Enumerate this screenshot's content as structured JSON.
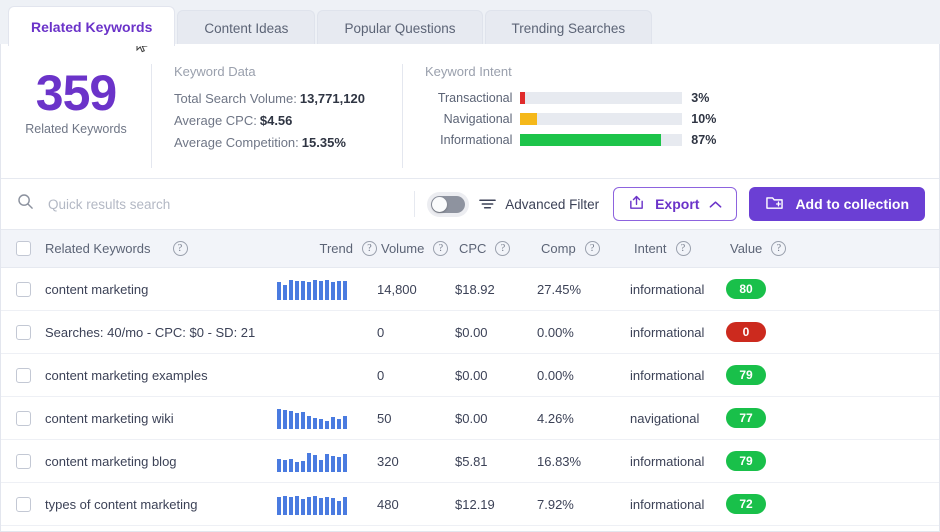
{
  "tabs": [
    {
      "label": "Related Keywords",
      "active": true
    },
    {
      "label": "Content Ideas",
      "active": false
    },
    {
      "label": "Popular Questions",
      "active": false
    },
    {
      "label": "Trending Searches",
      "active": false
    }
  ],
  "summary": {
    "count": "359",
    "count_label": "Related Keywords",
    "keyword_data": {
      "title": "Keyword Data",
      "rows": [
        {
          "label": "Total Search Volume:",
          "value": "13,771,120"
        },
        {
          "label": "Average CPC:",
          "value": "$4.56"
        },
        {
          "label": "Average Competition:",
          "value": "15.35%"
        }
      ]
    },
    "keyword_intent": {
      "title": "Keyword Intent",
      "rows": [
        {
          "label": "Transactional",
          "percent": "3%",
          "fill": 3,
          "color": "#e02b2b"
        },
        {
          "label": "Navigational",
          "percent": "10%",
          "fill": 10,
          "color": "#f5b81a"
        },
        {
          "label": "Informational",
          "percent": "87%",
          "fill": 87,
          "color": "#1dc44a"
        }
      ]
    }
  },
  "toolbar": {
    "search_placeholder": "Quick results search",
    "search_value": "",
    "search_icon": "search-icon",
    "toggle_state": "off",
    "advanced_filter_label": "Advanced Filter",
    "advanced_filter_icon": "filter-icon",
    "export_label": "Export",
    "export_icon": "share-export-icon",
    "export_caret": "chevron-up-icon",
    "add_to_collection_label": "Add to collection",
    "add_to_collection_icon": "folder-plus-icon",
    "accent_purple": "#6b3fd4"
  },
  "table": {
    "columns": [
      {
        "key": "keyword",
        "label": "Related Keywords",
        "help": true
      },
      {
        "key": "trend",
        "label": "Trend",
        "help": true
      },
      {
        "key": "volume",
        "label": "Volume",
        "help": true
      },
      {
        "key": "cpc",
        "label": "CPC",
        "help": true
      },
      {
        "key": "comp",
        "label": "Comp",
        "help": true
      },
      {
        "key": "intent",
        "label": "Intent",
        "help": true
      },
      {
        "key": "value",
        "label": "Value",
        "help": true
      }
    ],
    "rows": [
      {
        "keyword": "content marketing",
        "trend": [
          85,
          72,
          96,
          90,
          92,
          88,
          93,
          90,
          95,
          88,
          92,
          90
        ],
        "volume": "14,800",
        "cpc": "$18.92",
        "comp": "27.45%",
        "intent": "informational",
        "value": "80",
        "value_color": "#19c04a",
        "checked": false
      },
      {
        "keyword": "Searches: 40/mo - CPC: $0 - SD: 21",
        "trend": [],
        "volume": "0",
        "cpc": "$0.00",
        "comp": "0.00%",
        "intent": "informational",
        "value": "0",
        "value_color": "#cc2a1e",
        "checked": false
      },
      {
        "keyword": "content marketing examples",
        "trend": [],
        "volume": "0",
        "cpc": "$0.00",
        "comp": "0.00%",
        "intent": "informational",
        "value": "79",
        "value_color": "#19c04a",
        "checked": false
      },
      {
        "keyword": "content marketing wiki",
        "trend": [
          95,
          90,
          88,
          78,
          82,
          62,
          52,
          48,
          40,
          58,
          50,
          62
        ],
        "volume": "50",
        "cpc": "$0.00",
        "comp": "4.26%",
        "intent": "navigational",
        "value": "77",
        "value_color": "#19c04a",
        "checked": false
      },
      {
        "keyword": "content marketing blog",
        "trend": [
          62,
          55,
          62,
          48,
          52,
          90,
          82,
          58,
          88,
          78,
          72,
          86
        ],
        "volume": "320",
        "cpc": "$5.81",
        "comp": "16.83%",
        "intent": "informational",
        "value": "79",
        "value_color": "#19c04a",
        "checked": false
      },
      {
        "keyword": "types of content marketing",
        "trend": [
          88,
          92,
          84,
          90,
          78,
          86,
          90,
          82,
          88,
          80,
          68,
          84
        ],
        "volume": "480",
        "cpc": "$12.19",
        "comp": "7.92%",
        "intent": "informational",
        "value": "72",
        "value_color": "#19c04a",
        "checked": false
      }
    ],
    "select_all_checked": false,
    "help_glyph": "?"
  }
}
